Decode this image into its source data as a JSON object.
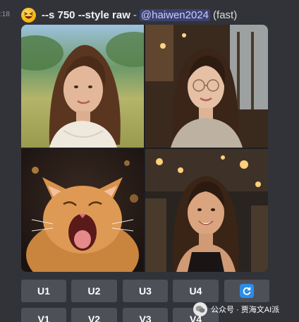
{
  "message": {
    "timestamp": ":18",
    "emoji_icon": "laughing-face-icon",
    "prompt": "--s 750 --style raw",
    "separator": "-",
    "mention": "@haiwen2024",
    "speed": "(fast)"
  },
  "images": [
    {
      "label": "woman-in-meadow"
    },
    {
      "label": "woman-with-glasses-in-cafe"
    },
    {
      "label": "orange-cat-yawning"
    },
    {
      "label": "woman-smiling-in-restaurant"
    }
  ],
  "buttons": {
    "upscale": [
      "U1",
      "U2",
      "U3",
      "U4"
    ],
    "variation": [
      "V1",
      "V2",
      "V3",
      "V4"
    ],
    "reroll_icon": "refresh-icon"
  },
  "watermark": {
    "text": "公众号 · 贾海文AI派",
    "icon": "wechat-icon"
  },
  "colors": {
    "background": "#313338",
    "button": "#4e5058",
    "mention_bg": "#3c4270",
    "reroll": "#2b8de8"
  }
}
